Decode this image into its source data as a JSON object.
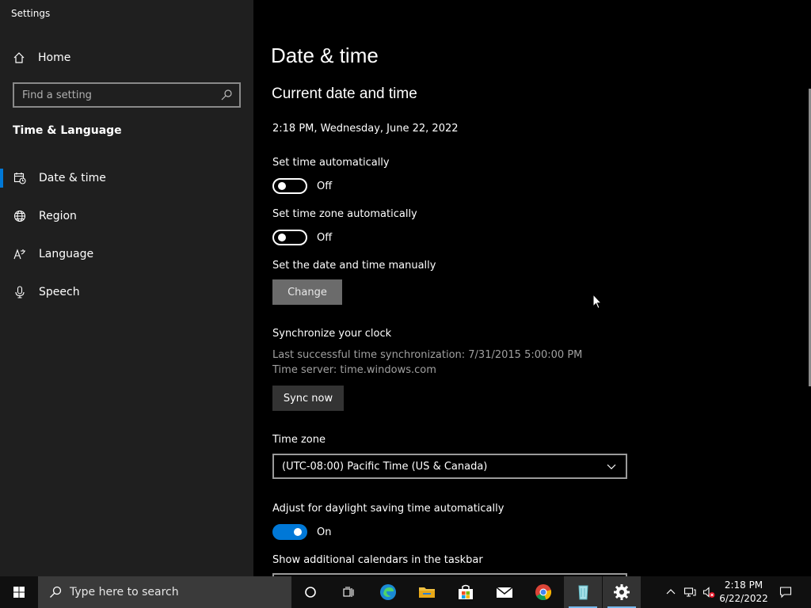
{
  "window": {
    "title": "Settings",
    "controls": [
      "minimize",
      "restore",
      "close"
    ]
  },
  "sidebar": {
    "home_label": "Home",
    "search_placeholder": "Find a setting",
    "section_title": "Time & Language",
    "items": [
      {
        "label": "Date & time",
        "icon": "calendar-clock-icon",
        "active": true
      },
      {
        "label": "Region",
        "icon": "globe-icon",
        "active": false
      },
      {
        "label": "Language",
        "icon": "language-icon",
        "active": false
      },
      {
        "label": "Speech",
        "icon": "microphone-icon",
        "active": false
      }
    ]
  },
  "main": {
    "page_title": "Date & time",
    "section_title": "Current date and time",
    "current_datetime": "2:18 PM, Wednesday, June 22, 2022",
    "set_time_auto": {
      "label": "Set time automatically",
      "state": "Off"
    },
    "set_timezone_auto": {
      "label": "Set time zone automatically",
      "state": "Off"
    },
    "manual": {
      "label": "Set the date and time manually",
      "button": "Change"
    },
    "sync": {
      "title": "Synchronize your clock",
      "last_sync": "Last successful time synchronization: 7/31/2015 5:00:00 PM",
      "server": "Time server: time.windows.com",
      "button": "Sync now"
    },
    "timezone": {
      "label": "Time zone",
      "value": "(UTC-08:00) Pacific Time (US & Canada)"
    },
    "dst": {
      "label": "Adjust for daylight saving time automatically",
      "state": "On"
    },
    "calendars_label": "Show additional calendars in the taskbar"
  },
  "taskbar": {
    "search_placeholder": "Type here to search",
    "time": "2:18 PM",
    "date": "6/22/2022"
  },
  "colors": {
    "accent": "#0078d7",
    "sidebar_bg": "#1f1f1f",
    "main_bg": "#000000",
    "taskbar_bg": "#101010"
  }
}
